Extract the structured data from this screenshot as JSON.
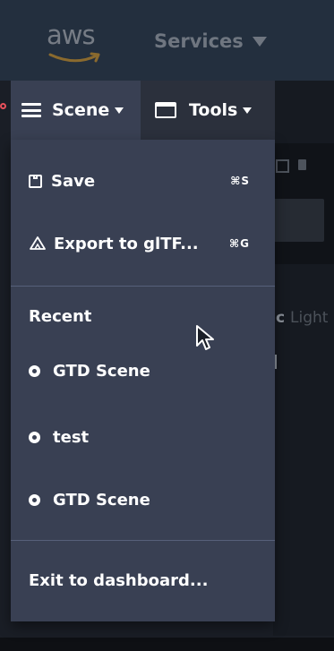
{
  "aws_nav": {
    "logo_text": "aws",
    "services_label": "Services"
  },
  "menubar": {
    "scene_label": "Scene",
    "tools_label": "Tools"
  },
  "scene_menu": {
    "save": {
      "label": "Save",
      "shortcut": "⌘S"
    },
    "export": {
      "label": "Export to glTF...",
      "shortcut": "⌘G"
    },
    "recent_heading": "Recent",
    "recent_items": [
      {
        "label": "GTD Scene"
      },
      {
        "label": "test"
      },
      {
        "label": "GTD Scene"
      }
    ],
    "exit": {
      "label": "Exit to dashboard..."
    }
  },
  "background": {
    "panel_text_bold": "c",
    "panel_text_dim": "Light"
  },
  "colors": {
    "menu_bg": "#394053",
    "aws_nav_bg": "#232f3e",
    "tools_bg": "#2b303c",
    "pointer_accent": "#e8505b"
  }
}
